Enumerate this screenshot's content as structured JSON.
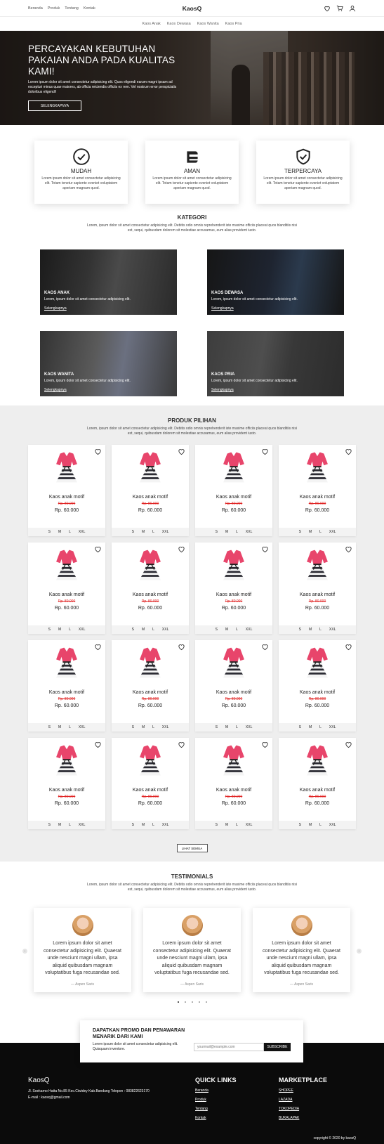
{
  "nav": {
    "links": [
      "Beranda",
      "Produk",
      "Tentang",
      "Kontak"
    ],
    "brand": "KaosQ",
    "icons": [
      "heart-icon",
      "cart-icon",
      "user-icon"
    ]
  },
  "subnav": [
    "Kaos Anak",
    "Kaos Dewasa",
    "Kaos Wanita",
    "Kaos Pria"
  ],
  "hero": {
    "title": "PERCAYAKAN KEBUTUHAN PAKAIAN ANDA PADA KUALITAS KAMI!",
    "text": "Lorem ipsum dolor sit amet consectetur adipisicing elit. Quos eligendi earum magni ipsam ad excepturi minus quae maiores, ab officia reiciendis officiis ex rem. Vel nostrum error perspiciatis doloribus eligendi!",
    "button": "SELENGKAPNYA"
  },
  "features": [
    {
      "icon": "check-circle-icon",
      "title": "MUDAH",
      "text": "Lorem ipsum dolor sit amet consectetur adipisicing elit. Totam tenetur sapiente eveniet voluptatem aperiam magnam quod."
    },
    {
      "icon": "card-icon",
      "title": "AMAN",
      "text": "Lorem ipsum dolor sit amet consectetur adipisicing elit. Totam tenetur sapiente eveniet voluptatem aperiam magnam quod."
    },
    {
      "icon": "shield-check-icon",
      "title": "TERPERCAYA",
      "text": "Lorem ipsum dolor sit amet consectetur adipisicing elit. Totam tenetur sapiente eveniet voluptatem aperiam magnam quod."
    }
  ],
  "kategori": {
    "title": "KATEGORI",
    "desc": "Lorem, ipsum dolor sit amet consectetur adipisicing elit. Debitis odio omnis reprehenderit iste maxime officiis placeat quos blanditiis nisi est, sequi, quibusdam dolorem sit molestiae accusamus, eum alias provident iusto.",
    "items": [
      {
        "title": "KAOS ANAK",
        "text": "Lorem, ipsum dolor sit amet consectetur adipisicing elit.",
        "link": "Selengkapnya"
      },
      {
        "title": "KAOS DEWASA",
        "text": "Lorem, ipsum dolor sit amet consectetur adipisicing elit.",
        "link": "Selengkapnya"
      },
      {
        "title": "KAOS WANITA",
        "text": "Lorem, ipsum dolor sit amet consectetur adipisicing elit.",
        "link": "Selengkapnya"
      },
      {
        "title": "KAOS PRIA",
        "text": "Lorem, ipsum dolor sit amet consectetur adipisicing elit.",
        "link": "Selengkapnya"
      }
    ]
  },
  "produk": {
    "title": "PRODUK PILIHAN",
    "desc": "Lorem, ipsum dolor sit amet consectetur adipisicing elit. Debitis odio omnis reprehenderit iste maxime officiis placeat quos blanditiis nisi est, sequi, quibusdam dolorem sit molestiae accusamus, eum alias provident iusto.",
    "items": [
      {
        "name": "Kaos anak motif",
        "old_price": "Rp. 80.000",
        "price": "Rp. 60.000",
        "sizes": [
          "S",
          "M",
          "L",
          "XXL"
        ]
      },
      {
        "name": "Kaos anak motif",
        "old_price": "Rp. 80.000",
        "price": "Rp. 60.000",
        "sizes": [
          "S",
          "M",
          "L",
          "XXL"
        ]
      },
      {
        "name": "Kaos anak motif",
        "old_price": "Rp. 80.000",
        "price": "Rp. 60.000",
        "sizes": [
          "S",
          "M",
          "L",
          "XXL"
        ]
      },
      {
        "name": "Kaos anak motif",
        "old_price": "Rp. 80.000",
        "price": "Rp. 60.000",
        "sizes": [
          "S",
          "M",
          "L",
          "XXL"
        ]
      },
      {
        "name": "Kaos anak motif",
        "old_price": "Rp. 80.000",
        "price": "Rp. 60.000",
        "sizes": [
          "S",
          "M",
          "L",
          "XXL"
        ]
      },
      {
        "name": "Kaos anak motif",
        "old_price": "Rp. 80.000",
        "price": "Rp. 60.000",
        "sizes": [
          "S",
          "M",
          "L",
          "XXL"
        ]
      },
      {
        "name": "Kaos anak motif",
        "old_price": "Rp. 80.000",
        "price": "Rp. 60.000",
        "sizes": [
          "S",
          "M",
          "L",
          "XXL"
        ]
      },
      {
        "name": "Kaos anak motif",
        "old_price": "Rp. 80.000",
        "price": "Rp. 60.000",
        "sizes": [
          "S",
          "M",
          "L",
          "XXL"
        ]
      },
      {
        "name": "Kaos anak motif",
        "old_price": "Rp. 80.000",
        "price": "Rp. 60.000",
        "sizes": [
          "S",
          "M",
          "L",
          "XXL"
        ]
      },
      {
        "name": "Kaos anak motif",
        "old_price": "Rp. 80.000",
        "price": "Rp. 60.000",
        "sizes": [
          "S",
          "M",
          "L",
          "XXL"
        ]
      },
      {
        "name": "Kaos anak motif",
        "old_price": "Rp. 80.000",
        "price": "Rp. 60.000",
        "sizes": [
          "S",
          "M",
          "L",
          "XXL"
        ]
      },
      {
        "name": "Kaos anak motif",
        "old_price": "Rp. 80.000",
        "price": "Rp. 60.000",
        "sizes": [
          "S",
          "M",
          "L",
          "XXL"
        ]
      },
      {
        "name": "Kaos anak motif",
        "old_price": "Rp. 80.000",
        "price": "Rp. 60.000",
        "sizes": [
          "S",
          "M",
          "L",
          "XXL"
        ]
      },
      {
        "name": "Kaos anak motif",
        "old_price": "Rp. 80.000",
        "price": "Rp. 60.000",
        "sizes": [
          "S",
          "M",
          "L",
          "XXL"
        ]
      },
      {
        "name": "Kaos anak motif",
        "old_price": "Rp. 80.000",
        "price": "Rp. 60.000",
        "sizes": [
          "S",
          "M",
          "L",
          "XXL"
        ]
      },
      {
        "name": "Kaos anak motif",
        "old_price": "Rp. 80.000",
        "price": "Rp. 60.000",
        "sizes": [
          "S",
          "M",
          "L",
          "XXL"
        ]
      }
    ],
    "see_all": "LIHAT SEMUA"
  },
  "testimonials": {
    "title": "TESTIMONIALS",
    "desc": "Lorem, ipsum dolor sit amet consectetur adipisicing elit. Debitis odio omnis reprehenderit iste maxime officiis placeat quos blanditiis nisi est, sequi, quibusdam dolorem sit molestiae accusamus, eum alias provident iusto.",
    "items": [
      {
        "text": "Lorem ipsum dolor sit amet consectetur adipisicing elit. Quaerat unde nesciunt magni ullam, ipsa aliquid quibusdam magnam voluptatibus fuga recusandae sed.",
        "author": "— Aspen Saris"
      },
      {
        "text": "Lorem ipsum dolor sit amet consectetur adipisicing elit. Quaerat unde nesciunt magni ullam, ipsa aliquid quibusdam magnam voluptatibus fuga recusandae sed.",
        "author": "— Aspen Saris"
      },
      {
        "text": "Lorem ipsum dolor sit amet consectetur adipisicing elit. Quaerat unde nesciunt magni ullam, ipsa aliquid quibusdam magnam voluptatibus fuga recusandae sed.",
        "author": "— Aspen Saris"
      }
    ],
    "prev": "‹",
    "next": "›"
  },
  "promo": {
    "title": "DAPATKAN PROMO DAN PENAWARAN MENARIK DARI KAMI",
    "text": "Lorem ipsum dolor sit amet consectetur adipisicing elit. Quisquam inventore.",
    "placeholder": "yourmail@example.com",
    "button": "SUBSCRIBE"
  },
  "footer": {
    "brand": "KaosQ",
    "address": "Jl. Soekarno Hatta No.85 Kec.Ciwidey Kab.Bandung Telepon : 083822623170",
    "email": "E-mail : kaosq@gmail.com",
    "quick_title": "QUICK LINKS",
    "quick_links": [
      "Beranda",
      "Produk",
      "Tentang",
      "Kontak"
    ],
    "market_title": "MARKETPLACE",
    "market_links": [
      "SHOPEE",
      "LAZADA",
      "TOKOPEDIA",
      "BUKALAPAK"
    ],
    "copyright": "copyright © 2020 by kaosQ"
  },
  "colors": {
    "accent_red": "#e02424",
    "dress_pink": "#e8456b",
    "footer_bg": "#0b0b0b"
  }
}
